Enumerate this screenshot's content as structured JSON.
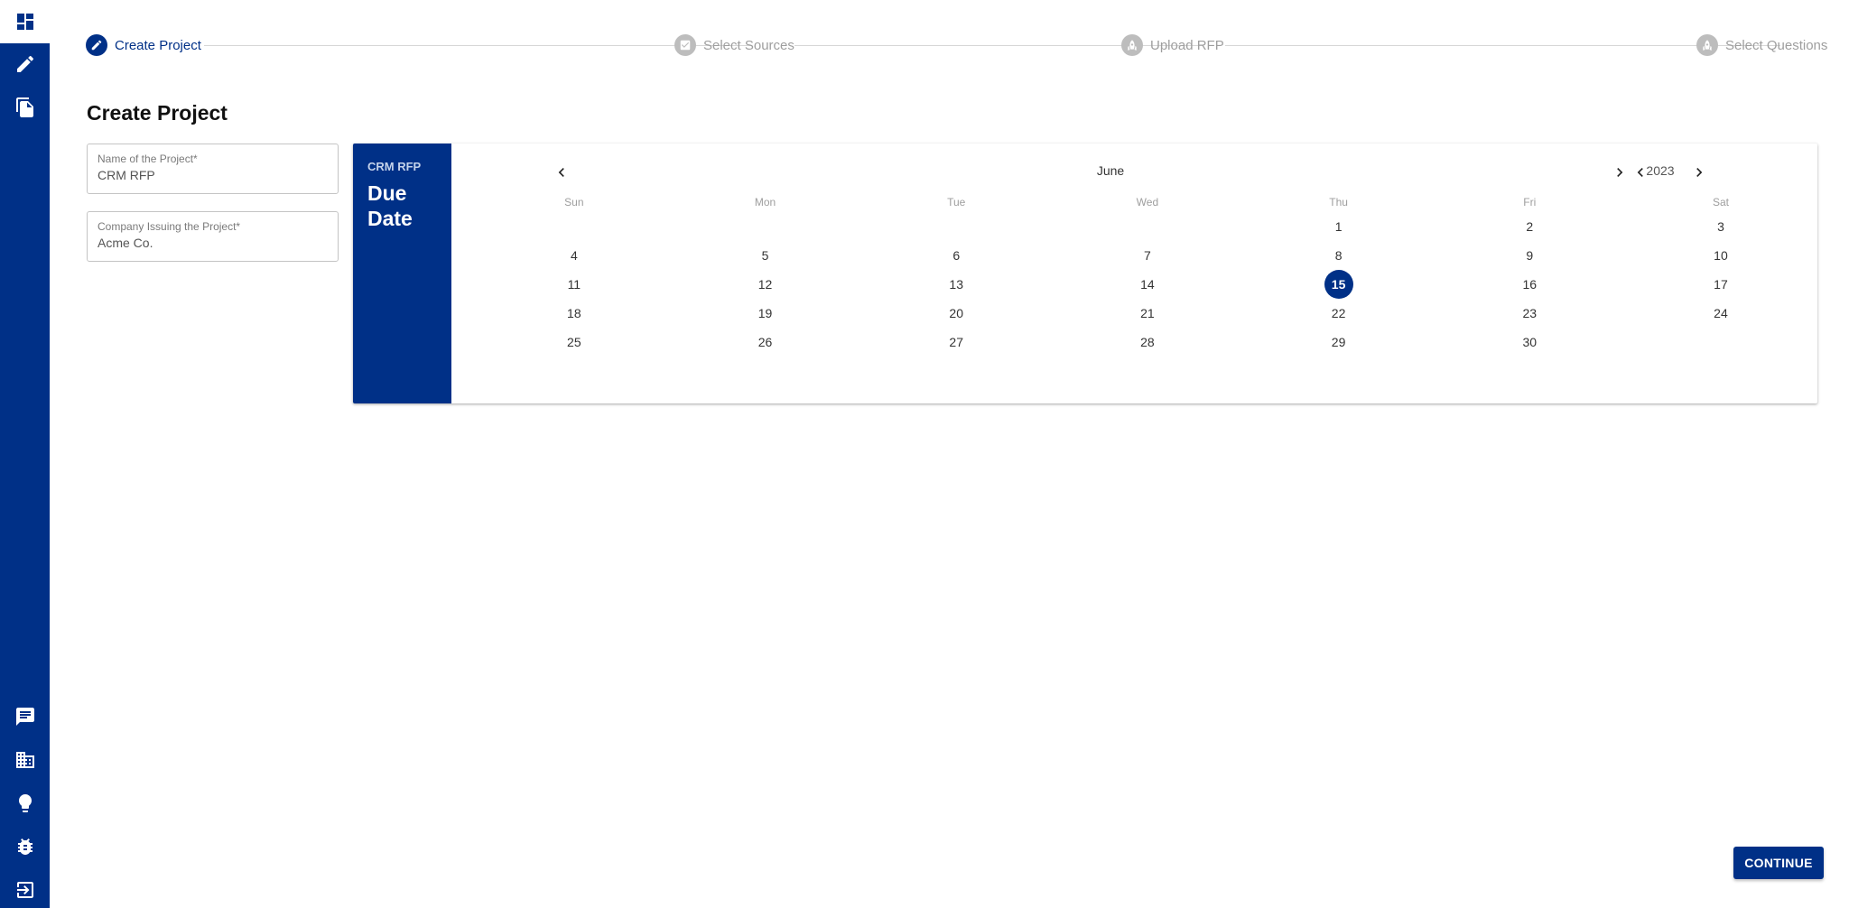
{
  "sidebar": {
    "top_items": [
      {
        "icon": "dashboard-icon"
      },
      {
        "icon": "edit-icon"
      },
      {
        "icon": "documents-icon"
      }
    ],
    "bottom_items": [
      {
        "icon": "chat-icon"
      },
      {
        "icon": "company-icon"
      },
      {
        "icon": "lightbulb-icon"
      },
      {
        "icon": "bug-icon"
      },
      {
        "icon": "logout-icon"
      }
    ]
  },
  "stepper": {
    "steps": [
      {
        "label": "Create Project",
        "icon": "pencil-icon",
        "active": true
      },
      {
        "label": "Select Sources",
        "icon": "checkbox-icon",
        "active": false
      },
      {
        "label": "Upload RFP",
        "icon": "rocket-icon",
        "active": false
      },
      {
        "label": "Select Questions",
        "icon": "rocket-icon",
        "active": false
      }
    ]
  },
  "page": {
    "title": "Create Project"
  },
  "form": {
    "project_name": {
      "label": "Name of the Project*",
      "value": "CRM RFP"
    },
    "company": {
      "label": "Company Issuing the Project*",
      "value": "Acme Co."
    }
  },
  "calendar": {
    "header_subtitle": "CRM RFP",
    "header_title": "Due Date",
    "month": "June",
    "year": "2023",
    "weekdays": [
      "Sun",
      "Mon",
      "Tue",
      "Wed",
      "Thu",
      "Fri",
      "Sat"
    ],
    "weeks": [
      [
        "",
        "",
        "",
        "",
        "1",
        "2",
        "3"
      ],
      [
        "4",
        "5",
        "6",
        "7",
        "8",
        "9",
        "10"
      ],
      [
        "11",
        "12",
        "13",
        "14",
        "15",
        "16",
        "17"
      ],
      [
        "18",
        "19",
        "20",
        "21",
        "22",
        "23",
        "24"
      ],
      [
        "25",
        "26",
        "27",
        "28",
        "29",
        "30",
        ""
      ]
    ],
    "selected_day": "15"
  },
  "actions": {
    "continue_label": "CONTINUE"
  },
  "colors": {
    "primary": "#003087",
    "inactive": "#bdbdbd"
  }
}
